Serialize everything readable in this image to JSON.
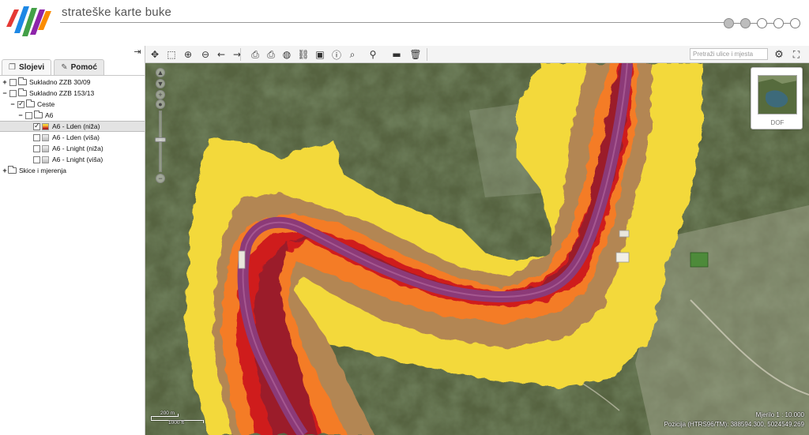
{
  "header": {
    "title": "strateške karte buke",
    "logo_colors": [
      "#e53935",
      "#1e88e5",
      "#43a047",
      "#8e24aa",
      "#fb8c00"
    ],
    "steps": [
      {
        "state": "done"
      },
      {
        "state": "done"
      },
      {
        "state": "todo"
      },
      {
        "state": "todo"
      },
      {
        "state": "todo"
      }
    ]
  },
  "left_panel": {
    "collapse_icon": "panel-collapse-icon",
    "tabs": [
      {
        "label": "Slojevi",
        "icon": "layers-icon",
        "active": true
      },
      {
        "label": "Pomoć",
        "icon": "help-icon",
        "active": false
      }
    ],
    "tree": [
      {
        "label": "Sukladno ZZB 30/09",
        "level": 0,
        "expander": "+",
        "checked": false,
        "type": "folder"
      },
      {
        "label": "Sukladno ZZB 153/13",
        "level": 0,
        "expander": "−",
        "checked": false,
        "type": "folder"
      },
      {
        "label": "Ceste",
        "level": 1,
        "expander": "−",
        "checked": true,
        "type": "folder"
      },
      {
        "label": "A6",
        "level": 2,
        "expander": "−",
        "checked": false,
        "type": "folder"
      },
      {
        "label": "A6 - Lden (niža)",
        "level": 3,
        "expander": "",
        "checked": true,
        "type": "layer",
        "selected": true
      },
      {
        "label": "A6 - Lden (viša)",
        "level": 3,
        "expander": "",
        "checked": false,
        "type": "layer"
      },
      {
        "label": "A6 - Lnight (niža)",
        "level": 3,
        "expander": "",
        "checked": false,
        "type": "layer"
      },
      {
        "label": "A6 - Lnight (viša)",
        "level": 3,
        "expander": "",
        "checked": false,
        "type": "layer"
      },
      {
        "label": "Skice i mjerenja",
        "level": 0,
        "expander": "+",
        "checked": null,
        "type": "folder"
      }
    ]
  },
  "toolbar": {
    "tools": [
      {
        "name": "pan-icon",
        "glyph": "✥"
      },
      {
        "name": "zoom-box-icon",
        "glyph": "⬚"
      },
      {
        "name": "zoom-in-icon",
        "glyph": "⊕"
      },
      {
        "name": "zoom-out-icon",
        "glyph": "⊖"
      },
      {
        "name": "back-arrow-icon",
        "glyph": "←"
      },
      {
        "name": "forward-arrow-icon",
        "glyph": "→"
      },
      {
        "name": "print-icon",
        "glyph": "⎙"
      },
      {
        "name": "print-coordinates-icon",
        "glyph": "⎙"
      },
      {
        "name": "globe-icon",
        "glyph": "◍"
      },
      {
        "name": "link-icon",
        "glyph": "⛓"
      },
      {
        "name": "identify-box-icon",
        "glyph": "▣"
      },
      {
        "name": "info-icon",
        "glyph": "ⓘ"
      },
      {
        "name": "search-icon",
        "glyph": "⌕"
      },
      {
        "name": "location-pin-icon",
        "glyph": "⚲"
      },
      {
        "name": "measure-icon",
        "glyph": "▬"
      },
      {
        "name": "delete-icon",
        "glyph": "🗑"
      }
    ],
    "search_placeholder": "Pretraži ulice i mjesta",
    "settings_icon": "gear-icon",
    "fullscreen_icon": "fullscreen-icon"
  },
  "map": {
    "overview_label": "DOF",
    "scale_top": "200 m",
    "scale_bottom": "1000 ft",
    "scale_text": "Mjerilo 1 : 10.000",
    "position_text": "Pozicija (HTRS96/TM): 388594.300, 5024549.269",
    "noise_colors": {
      "yellow": "#f3d93a",
      "tan": "#b38653",
      "orange": "#f47b25",
      "red": "#cf1f1f",
      "darkred": "#9b1b2a",
      "purple": "#8c3a78"
    }
  }
}
